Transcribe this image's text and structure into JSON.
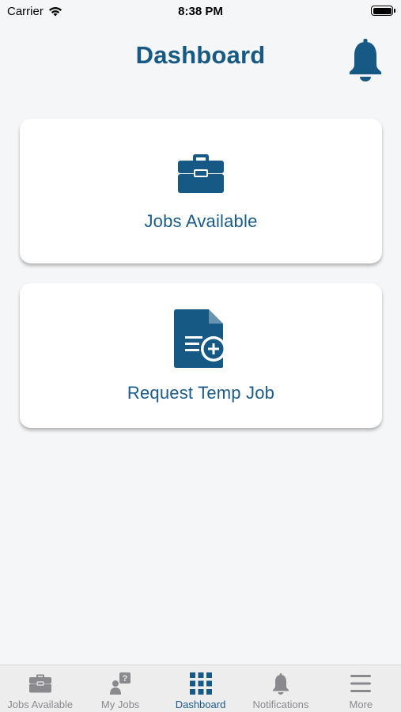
{
  "status_bar": {
    "carrier": "Carrier",
    "time": "8:38 PM"
  },
  "header": {
    "title": "Dashboard"
  },
  "cards": [
    {
      "label": "Jobs Available",
      "icon": "briefcase-icon"
    },
    {
      "label": "Request Temp Job",
      "icon": "document-add-icon"
    }
  ],
  "tabs": [
    {
      "label": "Jobs Available",
      "icon": "briefcase-icon"
    },
    {
      "label": "My Jobs",
      "icon": "person-question-icon"
    },
    {
      "label": "Dashboard",
      "icon": "grid-icon",
      "active": true
    },
    {
      "label": "Notifications",
      "icon": "bell-icon"
    },
    {
      "label": "More",
      "icon": "menu-icon"
    }
  ],
  "colors": {
    "accent": "#165985",
    "inactive": "#8a8a8e",
    "background": "#f5f6f8"
  }
}
